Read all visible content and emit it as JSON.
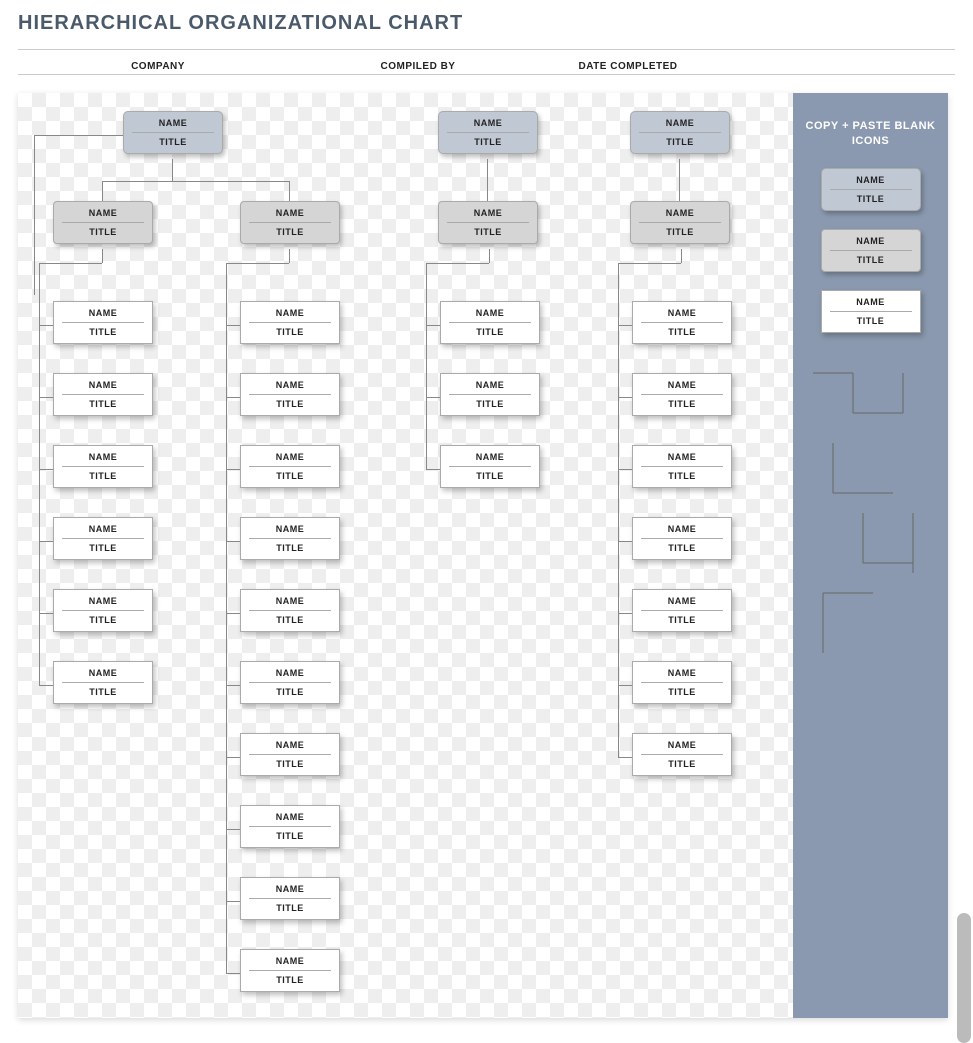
{
  "header": {
    "title": "HIERARCHICAL ORGANIZATIONAL CHART",
    "meta": {
      "company": "COMPANY",
      "compiled_by": "COMPILED BY",
      "date_completed": "DATE COMPLETED"
    }
  },
  "labels": {
    "name": "NAME",
    "title": "TITLE"
  },
  "panel": {
    "heading": "COPY + PASTE BLANK ICONS"
  },
  "chart": {
    "columns": [
      {
        "id": "A",
        "top": {
          "name": "NAME",
          "title": "TITLE",
          "style": "blue"
        },
        "mid": {
          "name": "NAME",
          "title": "TITLE",
          "style": "grey"
        },
        "leaves": [
          {
            "name": "NAME",
            "title": "TITLE"
          },
          {
            "name": "NAME",
            "title": "TITLE"
          },
          {
            "name": "NAME",
            "title": "TITLE"
          },
          {
            "name": "NAME",
            "title": "TITLE"
          },
          {
            "name": "NAME",
            "title": "TITLE"
          },
          {
            "name": "NAME",
            "title": "TITLE"
          }
        ]
      },
      {
        "id": "B",
        "mid": {
          "name": "NAME",
          "title": "TITLE",
          "style": "grey"
        },
        "leaves": [
          {
            "name": "NAME",
            "title": "TITLE"
          },
          {
            "name": "NAME",
            "title": "TITLE"
          },
          {
            "name": "NAME",
            "title": "TITLE"
          },
          {
            "name": "NAME",
            "title": "TITLE"
          },
          {
            "name": "NAME",
            "title": "TITLE"
          },
          {
            "name": "NAME",
            "title": "TITLE"
          },
          {
            "name": "NAME",
            "title": "TITLE"
          },
          {
            "name": "NAME",
            "title": "TITLE"
          },
          {
            "name": "NAME",
            "title": "TITLE"
          },
          {
            "name": "NAME",
            "title": "TITLE"
          }
        ]
      },
      {
        "id": "C",
        "top": {
          "name": "NAME",
          "title": "TITLE",
          "style": "blue"
        },
        "mid": {
          "name": "NAME",
          "title": "TITLE",
          "style": "grey"
        },
        "leaves": [
          {
            "name": "NAME",
            "title": "TITLE"
          },
          {
            "name": "NAME",
            "title": "TITLE"
          },
          {
            "name": "NAME",
            "title": "TITLE"
          }
        ]
      },
      {
        "id": "D",
        "top": {
          "name": "NAME",
          "title": "TITLE",
          "style": "blue"
        },
        "mid": {
          "name": "NAME",
          "title": "TITLE",
          "style": "grey"
        },
        "leaves": [
          {
            "name": "NAME",
            "title": "TITLE"
          },
          {
            "name": "NAME",
            "title": "TITLE"
          },
          {
            "name": "NAME",
            "title": "TITLE"
          },
          {
            "name": "NAME",
            "title": "TITLE"
          },
          {
            "name": "NAME",
            "title": "TITLE"
          },
          {
            "name": "NAME",
            "title": "TITLE"
          },
          {
            "name": "NAME",
            "title": "TITLE"
          }
        ]
      }
    ],
    "palette": [
      {
        "name": "NAME",
        "title": "TITLE",
        "style": "blue"
      },
      {
        "name": "NAME",
        "title": "TITLE",
        "style": "grey"
      },
      {
        "name": "NAME",
        "title": "TITLE",
        "style": "white"
      }
    ]
  }
}
